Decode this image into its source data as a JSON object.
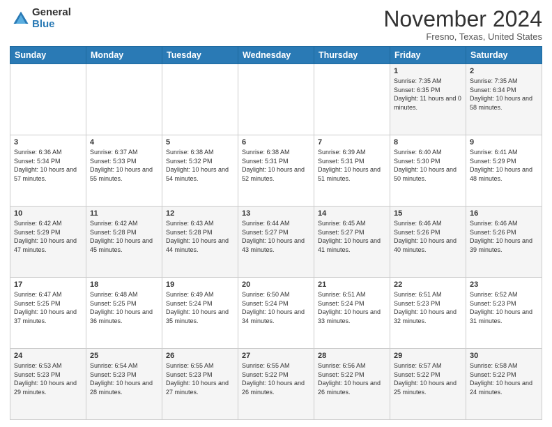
{
  "logo": {
    "general": "General",
    "blue": "Blue"
  },
  "title": "November 2024",
  "location": "Fresno, Texas, United States",
  "days_of_week": [
    "Sunday",
    "Monday",
    "Tuesday",
    "Wednesday",
    "Thursday",
    "Friday",
    "Saturday"
  ],
  "weeks": [
    [
      {
        "day": "",
        "info": ""
      },
      {
        "day": "",
        "info": ""
      },
      {
        "day": "",
        "info": ""
      },
      {
        "day": "",
        "info": ""
      },
      {
        "day": "",
        "info": ""
      },
      {
        "day": "1",
        "info": "Sunrise: 7:35 AM\nSunset: 6:35 PM\nDaylight: 11 hours and 0 minutes."
      },
      {
        "day": "2",
        "info": "Sunrise: 7:35 AM\nSunset: 6:34 PM\nDaylight: 10 hours and 58 minutes."
      }
    ],
    [
      {
        "day": "3",
        "info": "Sunrise: 6:36 AM\nSunset: 5:34 PM\nDaylight: 10 hours and 57 minutes."
      },
      {
        "day": "4",
        "info": "Sunrise: 6:37 AM\nSunset: 5:33 PM\nDaylight: 10 hours and 55 minutes."
      },
      {
        "day": "5",
        "info": "Sunrise: 6:38 AM\nSunset: 5:32 PM\nDaylight: 10 hours and 54 minutes."
      },
      {
        "day": "6",
        "info": "Sunrise: 6:38 AM\nSunset: 5:31 PM\nDaylight: 10 hours and 52 minutes."
      },
      {
        "day": "7",
        "info": "Sunrise: 6:39 AM\nSunset: 5:31 PM\nDaylight: 10 hours and 51 minutes."
      },
      {
        "day": "8",
        "info": "Sunrise: 6:40 AM\nSunset: 5:30 PM\nDaylight: 10 hours and 50 minutes."
      },
      {
        "day": "9",
        "info": "Sunrise: 6:41 AM\nSunset: 5:29 PM\nDaylight: 10 hours and 48 minutes."
      }
    ],
    [
      {
        "day": "10",
        "info": "Sunrise: 6:42 AM\nSunset: 5:29 PM\nDaylight: 10 hours and 47 minutes."
      },
      {
        "day": "11",
        "info": "Sunrise: 6:42 AM\nSunset: 5:28 PM\nDaylight: 10 hours and 45 minutes."
      },
      {
        "day": "12",
        "info": "Sunrise: 6:43 AM\nSunset: 5:28 PM\nDaylight: 10 hours and 44 minutes."
      },
      {
        "day": "13",
        "info": "Sunrise: 6:44 AM\nSunset: 5:27 PM\nDaylight: 10 hours and 43 minutes."
      },
      {
        "day": "14",
        "info": "Sunrise: 6:45 AM\nSunset: 5:27 PM\nDaylight: 10 hours and 41 minutes."
      },
      {
        "day": "15",
        "info": "Sunrise: 6:46 AM\nSunset: 5:26 PM\nDaylight: 10 hours and 40 minutes."
      },
      {
        "day": "16",
        "info": "Sunrise: 6:46 AM\nSunset: 5:26 PM\nDaylight: 10 hours and 39 minutes."
      }
    ],
    [
      {
        "day": "17",
        "info": "Sunrise: 6:47 AM\nSunset: 5:25 PM\nDaylight: 10 hours and 37 minutes."
      },
      {
        "day": "18",
        "info": "Sunrise: 6:48 AM\nSunset: 5:25 PM\nDaylight: 10 hours and 36 minutes."
      },
      {
        "day": "19",
        "info": "Sunrise: 6:49 AM\nSunset: 5:24 PM\nDaylight: 10 hours and 35 minutes."
      },
      {
        "day": "20",
        "info": "Sunrise: 6:50 AM\nSunset: 5:24 PM\nDaylight: 10 hours and 34 minutes."
      },
      {
        "day": "21",
        "info": "Sunrise: 6:51 AM\nSunset: 5:24 PM\nDaylight: 10 hours and 33 minutes."
      },
      {
        "day": "22",
        "info": "Sunrise: 6:51 AM\nSunset: 5:23 PM\nDaylight: 10 hours and 32 minutes."
      },
      {
        "day": "23",
        "info": "Sunrise: 6:52 AM\nSunset: 5:23 PM\nDaylight: 10 hours and 31 minutes."
      }
    ],
    [
      {
        "day": "24",
        "info": "Sunrise: 6:53 AM\nSunset: 5:23 PM\nDaylight: 10 hours and 29 minutes."
      },
      {
        "day": "25",
        "info": "Sunrise: 6:54 AM\nSunset: 5:23 PM\nDaylight: 10 hours and 28 minutes."
      },
      {
        "day": "26",
        "info": "Sunrise: 6:55 AM\nSunset: 5:23 PM\nDaylight: 10 hours and 27 minutes."
      },
      {
        "day": "27",
        "info": "Sunrise: 6:55 AM\nSunset: 5:22 PM\nDaylight: 10 hours and 26 minutes."
      },
      {
        "day": "28",
        "info": "Sunrise: 6:56 AM\nSunset: 5:22 PM\nDaylight: 10 hours and 26 minutes."
      },
      {
        "day": "29",
        "info": "Sunrise: 6:57 AM\nSunset: 5:22 PM\nDaylight: 10 hours and 25 minutes."
      },
      {
        "day": "30",
        "info": "Sunrise: 6:58 AM\nSunset: 5:22 PM\nDaylight: 10 hours and 24 minutes."
      }
    ]
  ]
}
